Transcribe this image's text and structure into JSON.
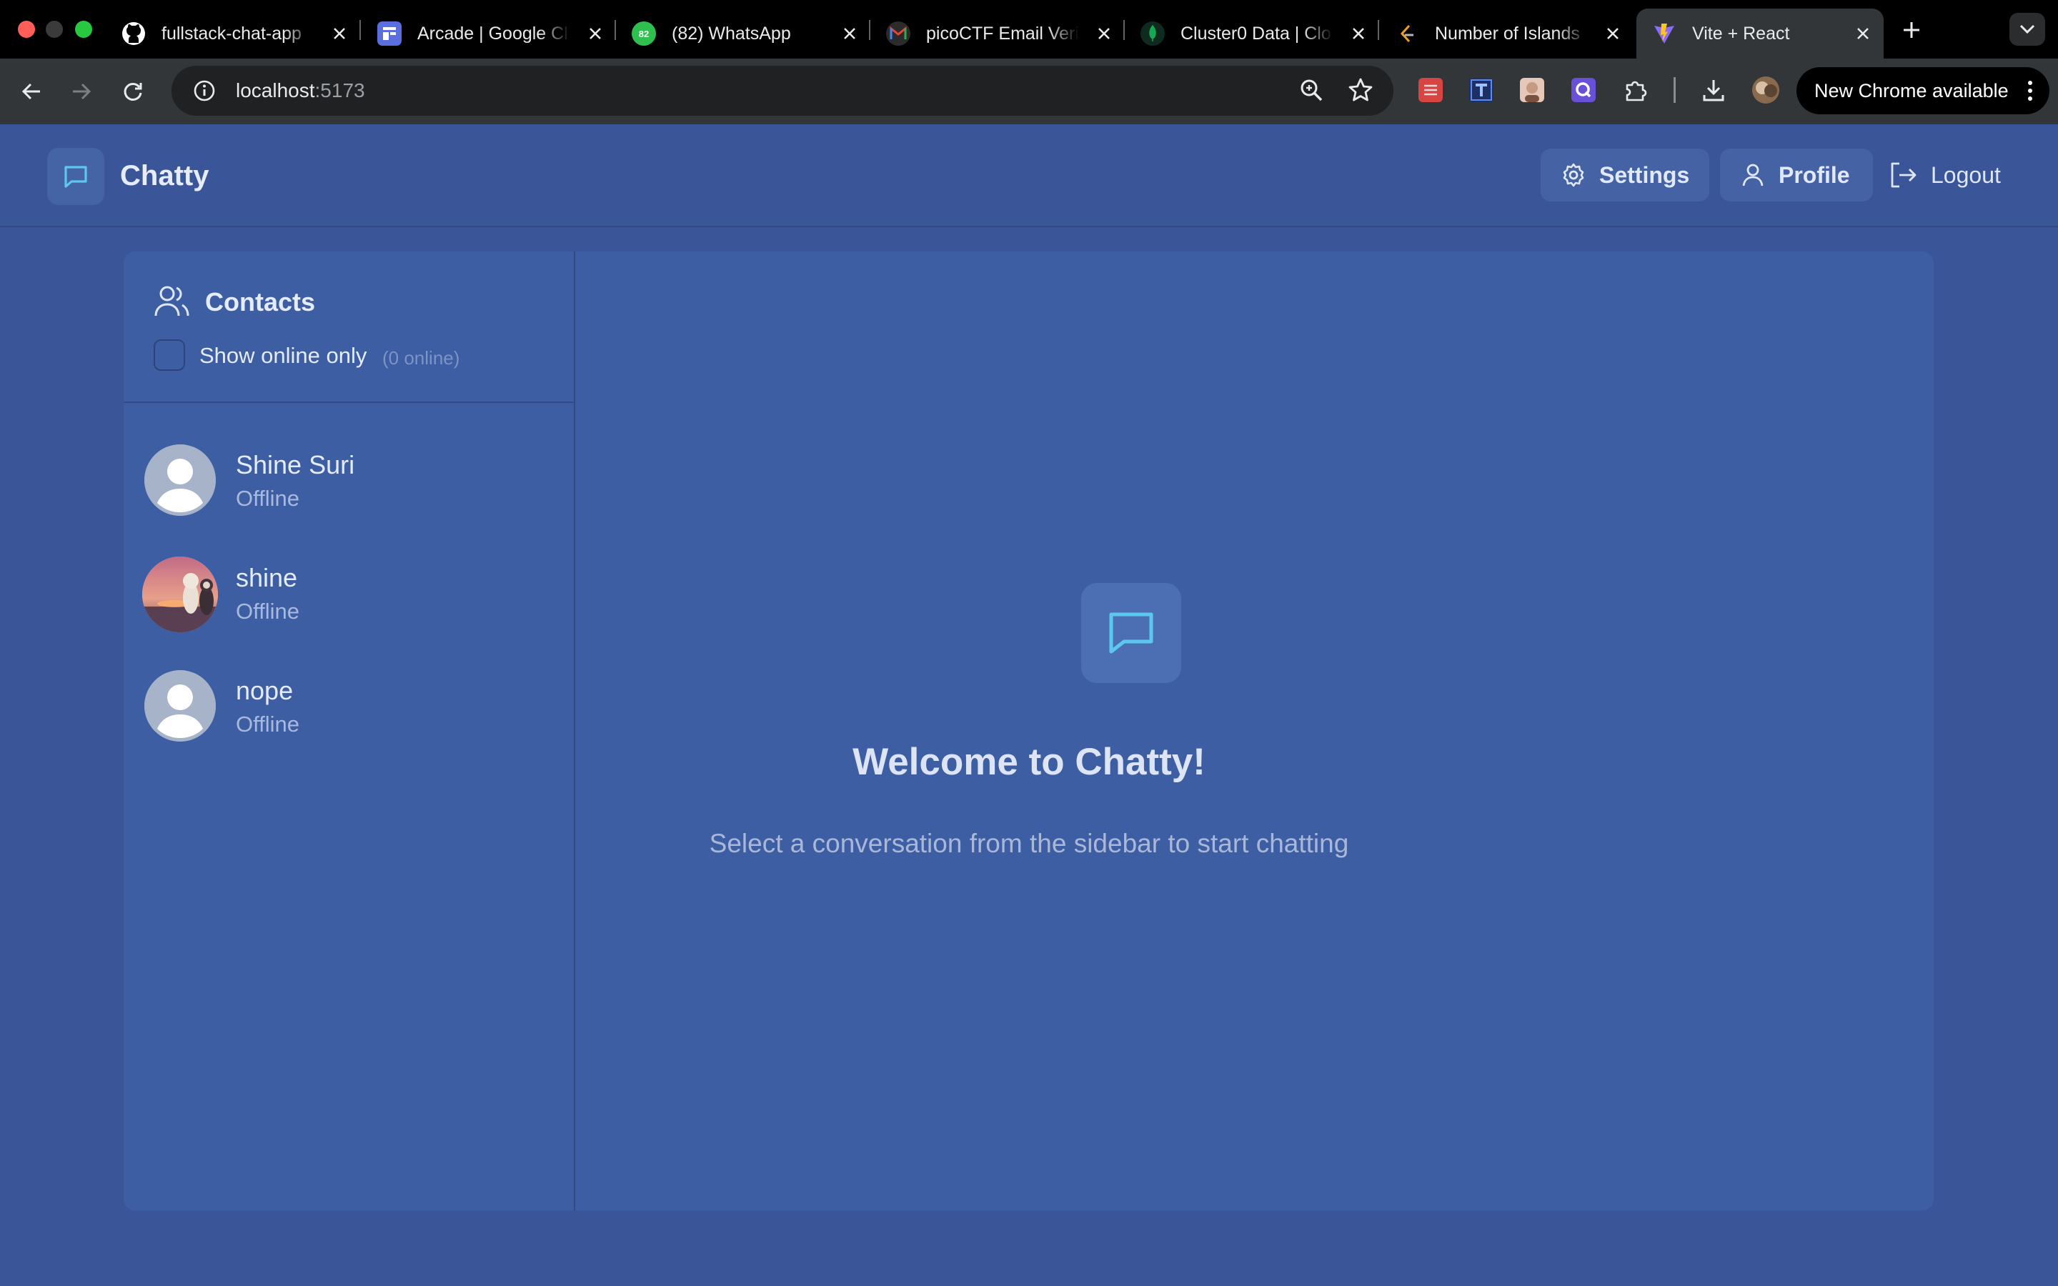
{
  "browser": {
    "tabs": [
      {
        "title": "fullstack-chat-app",
        "icon": "github-icon"
      },
      {
        "title": "Arcade | Google Cl",
        "icon": "arcade-icon"
      },
      {
        "title": "(82) WhatsApp",
        "icon": "whatsapp-icon",
        "badge": "82"
      },
      {
        "title": "picoCTF Email Veri",
        "icon": "gmail-icon"
      },
      {
        "title": "Cluster0 Data | Clo",
        "icon": "mongodb-leaf-icon"
      },
      {
        "title": "Number of Islands",
        "icon": "leetcode-icon"
      },
      {
        "title": "Vite + React",
        "icon": "vite-icon",
        "active": true
      }
    ],
    "url_host": "localhost",
    "url_port": ":5173",
    "update_label": "New Chrome available",
    "colors": {
      "tab_strip": "#000000",
      "toolbar": "#323639",
      "omnibox": "#1f2123"
    }
  },
  "app": {
    "title": "Chatty",
    "header": {
      "settings_label": "Settings",
      "profile_label": "Profile",
      "logout_label": "Logout"
    },
    "colors": {
      "background": "#3a5698",
      "card": "#3e5ea3",
      "accent": "#5cc8f0"
    }
  },
  "sidebar": {
    "title": "Contacts",
    "online_filter_label": "Show online only",
    "online_count": "(0 online)",
    "contacts": [
      {
        "name": "Shine Suri",
        "status": "Offline",
        "avatar": "default-avatar"
      },
      {
        "name": "shine",
        "status": "Offline",
        "avatar": "photo-avatar"
      },
      {
        "name": "nope",
        "status": "Offline",
        "avatar": "default-avatar"
      }
    ]
  },
  "welcome": {
    "title": "Welcome to Chatty!",
    "subtitle": "Select a conversation from the sidebar to start chatting"
  }
}
